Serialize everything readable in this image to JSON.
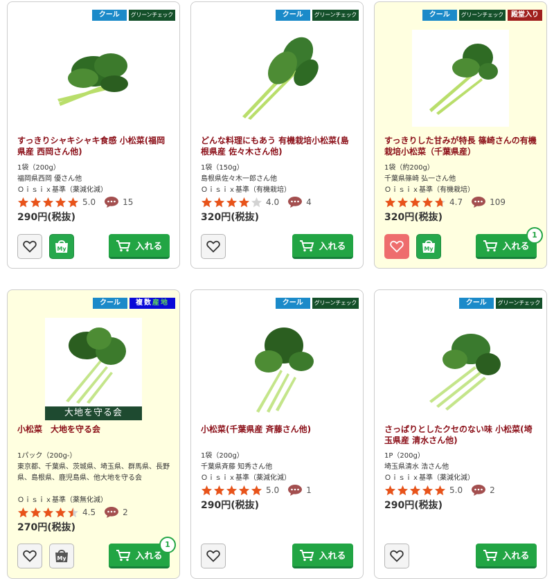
{
  "labels": {
    "cool": "クール",
    "green_check": "グリーンチェック",
    "hall_of_fame": "殿堂入り",
    "multi_origin_a": "複数",
    "multi_origin_b": "産地",
    "cart": "入れる",
    "my": "My"
  },
  "colors": {
    "title": "#8b0f18",
    "cool_badge": "#1b8ac9",
    "green_badge": "#14502a",
    "cart_button": "#22a544",
    "star": "#e8531a",
    "highlight_bg": "#ffffe0"
  },
  "products": [
    {
      "title": "すっきりシャキシャキ食感 小松菜(福岡県産 西岡さん他)",
      "size": "1袋（200g）",
      "producer": "福岡県西岡 優さん他",
      "standard": "Ｏｉｓｉｘ基準（薬減化減）",
      "rating": 5.0,
      "rating_text": "5.0",
      "reviews": "15",
      "price": "290円(税抜)",
      "badges": [
        "cool",
        "green"
      ],
      "favorite": false,
      "my": true,
      "qty": ""
    },
    {
      "title": "どんな料理にもあう 有機栽培小松菜(島根県産 佐々木さん他)",
      "size": "1袋（150g）",
      "producer": "島根県佐々木一郎さん他",
      "standard": "Ｏｉｓｉｘ基準（有機栽培）",
      "rating": 4.0,
      "rating_text": "4.0",
      "reviews": "4",
      "price": "320円(税抜)",
      "badges": [
        "cool",
        "green"
      ],
      "favorite": false,
      "my": false,
      "qty": ""
    },
    {
      "title": "すっきりした甘みが特長 篠崎さんの有機栽培小松菜（千葉県産）",
      "size": "1袋（約200g）",
      "producer": "千葉県篠崎 弘一さん他",
      "standard": "Ｏｉｓｉｘ基準（有機栽培）",
      "rating": 4.7,
      "rating_text": "4.7",
      "reviews": "109",
      "price": "320円(税抜)",
      "badges": [
        "cool",
        "green",
        "hall"
      ],
      "favorite": true,
      "my": true,
      "qty": "1"
    },
    {
      "title": "小松菜　大地を守る会",
      "size": "1パック（200g-）",
      "producer": "東京都、千葉県、茨城県、埼玉県、群馬県、長野県、島根県、鹿児島県、他大地を守る会",
      "standard": "Ｏｉｓｉｘ基準（薬無化減）",
      "rating": 4.5,
      "rating_text": "4.5",
      "reviews": "2",
      "price": "270円(税抜)",
      "photo_tag": "大地を守る会",
      "badges": [
        "cool",
        "multi"
      ],
      "favorite": false,
      "my": false,
      "qty": "1"
    },
    {
      "title": "小松菜(千葉県産 斉藤さん他)",
      "size": "1袋（200g）",
      "producer": "千葉県斉藤 知秀さん他",
      "standard": "Ｏｉｓｉｘ基準（薬減化減）",
      "rating": 5.0,
      "rating_text": "5.0",
      "reviews": "1",
      "price": "290円(税抜)",
      "badges": [
        "cool",
        "green"
      ],
      "favorite": false,
      "my": null,
      "qty": ""
    },
    {
      "title": "さっぱりとしたクセのない味 小松菜(埼玉県産 清水さん他)",
      "size": "1P（200g）",
      "producer": "埼玉県清水 浩さん他",
      "standard": "Ｏｉｓｉｘ基準（薬減化減）",
      "rating": 5.0,
      "rating_text": "5.0",
      "reviews": "2",
      "price": "290円(税抜)",
      "badges": [
        "cool",
        "green"
      ],
      "favorite": false,
      "my": null,
      "qty": ""
    }
  ]
}
